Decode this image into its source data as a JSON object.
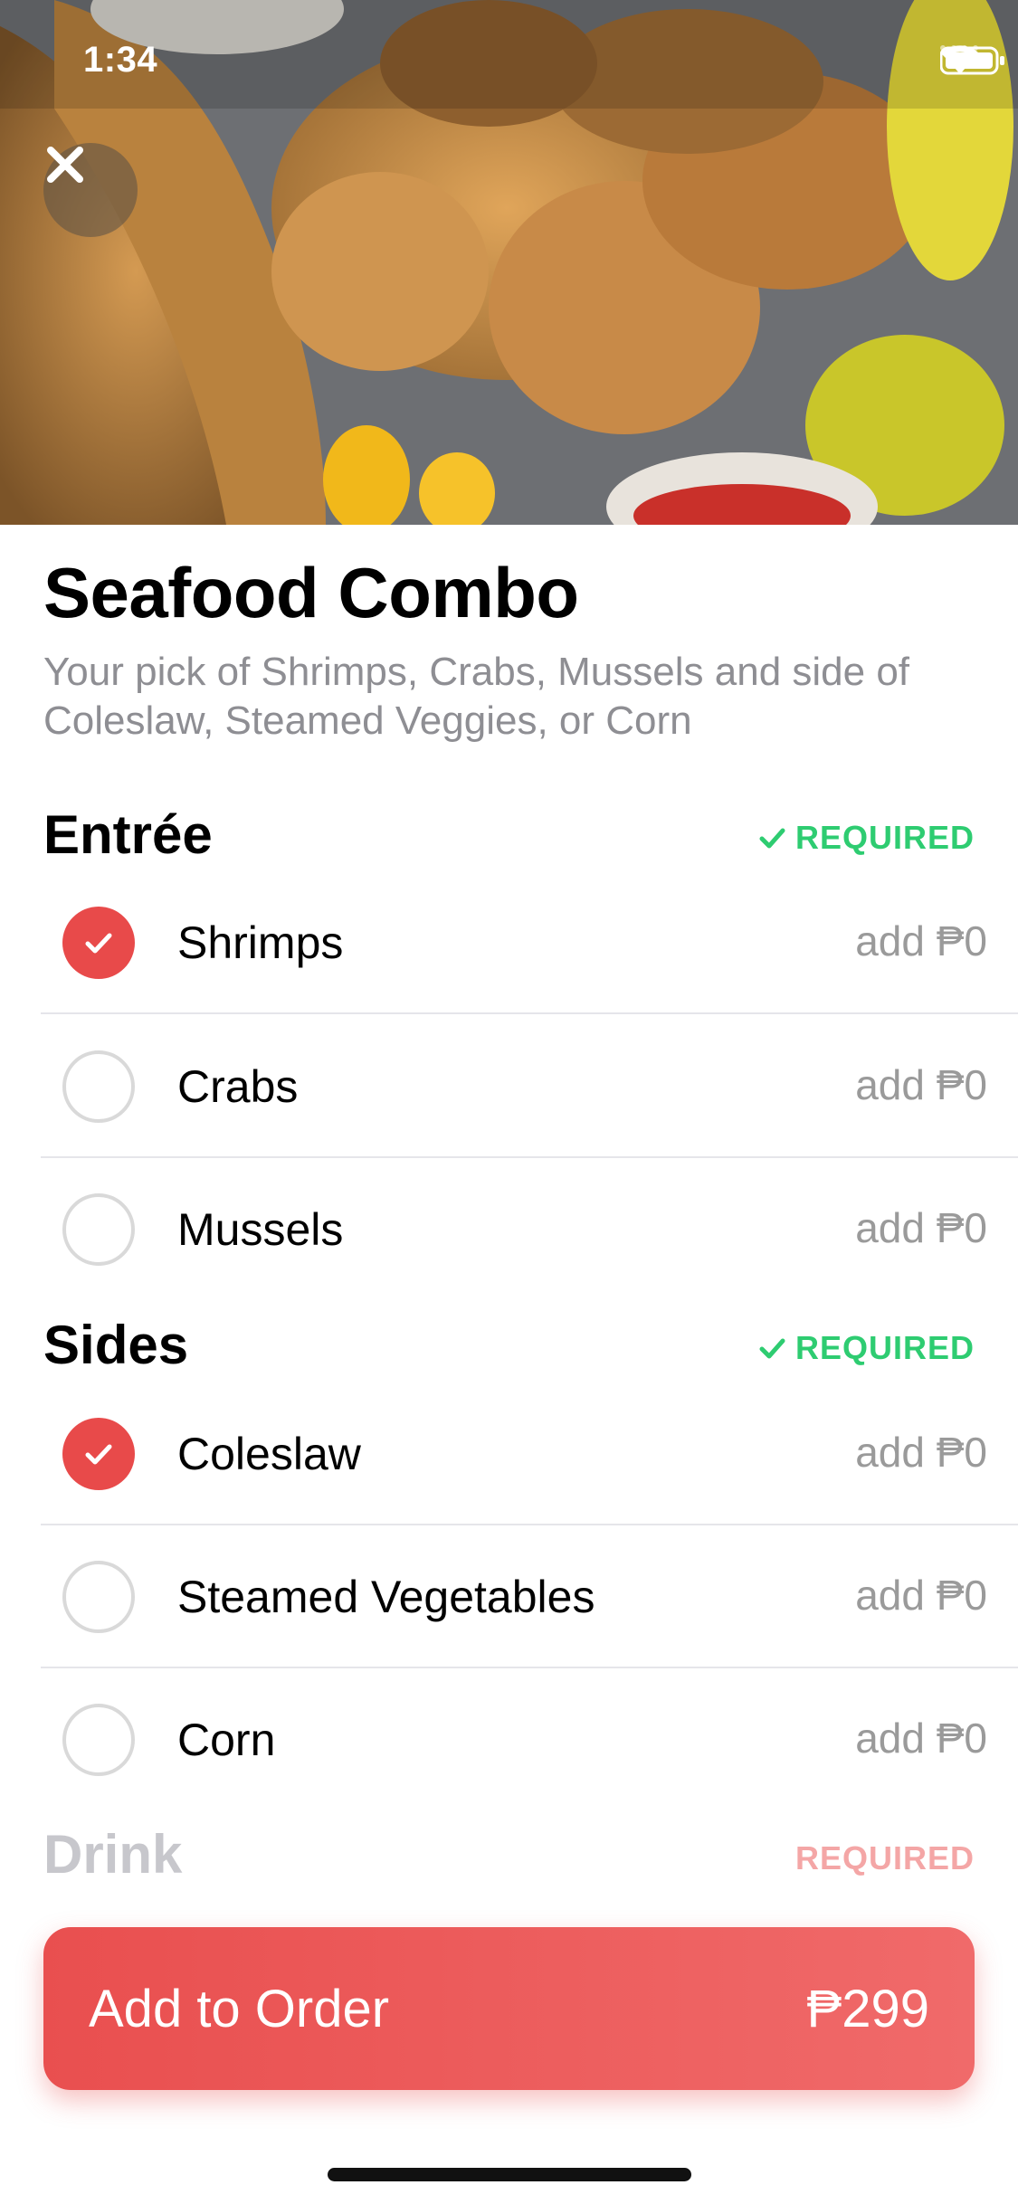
{
  "status_bar": {
    "time": "1:34"
  },
  "item": {
    "title": "Seafood Combo",
    "description": "Your pick of Shrimps, Crabs, Mussels and side of Coleslaw, Steamed Veggies, or Corn"
  },
  "sections": [
    {
      "title": "Entrée",
      "required_label": "REQUIRED",
      "options": [
        {
          "label": "Shrimps",
          "price": "add ₱0",
          "selected": true
        },
        {
          "label": "Crabs",
          "price": "add ₱0",
          "selected": false
        },
        {
          "label": "Mussels",
          "price": "add ₱0",
          "selected": false
        }
      ]
    },
    {
      "title": "Sides",
      "required_label": "REQUIRED",
      "options": [
        {
          "label": "Coleslaw",
          "price": "add ₱0",
          "selected": true
        },
        {
          "label": "Steamed Vegetables",
          "price": "add ₱0",
          "selected": false
        },
        {
          "label": "Corn",
          "price": "add ₱0",
          "selected": false
        }
      ]
    },
    {
      "title": "Drink",
      "required_label": "REQUIRED"
    }
  ],
  "cta": {
    "label": "Add to Order",
    "price": "₱299"
  },
  "colors": {
    "accent_red": "#e84a4a",
    "required_green": "#2ecc71",
    "muted_text": "#8e8e93"
  },
  "icons": [
    "close-icon",
    "wifi-icon",
    "battery-icon",
    "check-icon"
  ]
}
